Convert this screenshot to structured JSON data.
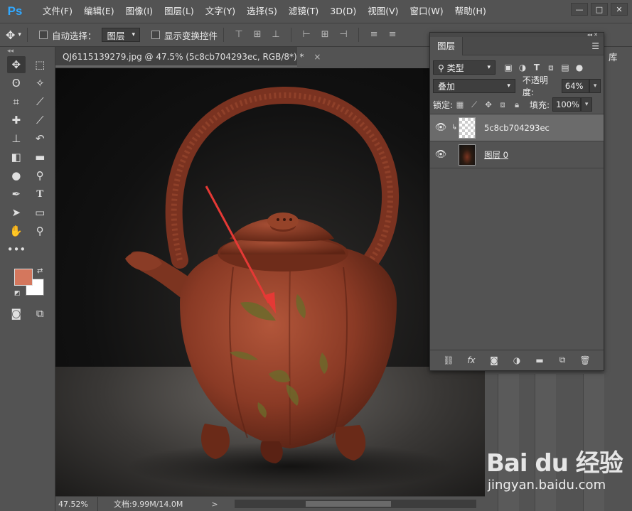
{
  "app": {
    "logo": "Ps"
  },
  "menu": [
    "文件(F)",
    "编辑(E)",
    "图像(I)",
    "图层(L)",
    "文字(Y)",
    "选择(S)",
    "滤镜(T)",
    "3D(D)",
    "视图(V)",
    "窗口(W)",
    "帮助(H)"
  ],
  "window_controls": {
    "minimize": "—",
    "restore": "□",
    "close": "✕"
  },
  "options": {
    "auto_select_label": "自动选择：",
    "auto_select_value": "图层",
    "show_transform_label": "显示变换控件"
  },
  "document": {
    "tab_title": "QJ6115139279.jpg @ 47.5% (5c8cb704293ec, RGB/8*) *",
    "tab_close": "×",
    "zoom": "47.52%",
    "doc_info": "文档:9.99M/14.0M",
    "doc_info_arrow": ">"
  },
  "colors": {
    "foreground": "#d4775d",
    "background": "#ffffff"
  },
  "right_dock": {
    "library_tab": "库"
  },
  "layers_panel": {
    "title": "图层",
    "filter_label": "类型",
    "blend_mode": "叠加",
    "opacity_label": "不透明度:",
    "opacity_value": "64%",
    "lock_label": "锁定:",
    "fill_label": "填充:",
    "fill_value": "100%",
    "layers": [
      {
        "name": "5c8cb704293ec",
        "visible": true,
        "selected": true,
        "clipped": true
      },
      {
        "name": "图层 0",
        "visible": true,
        "selected": false,
        "clipped": false
      }
    ]
  },
  "watermark": {
    "logo": "Bai du 经验",
    "url": "jingyan.baidu.com"
  }
}
